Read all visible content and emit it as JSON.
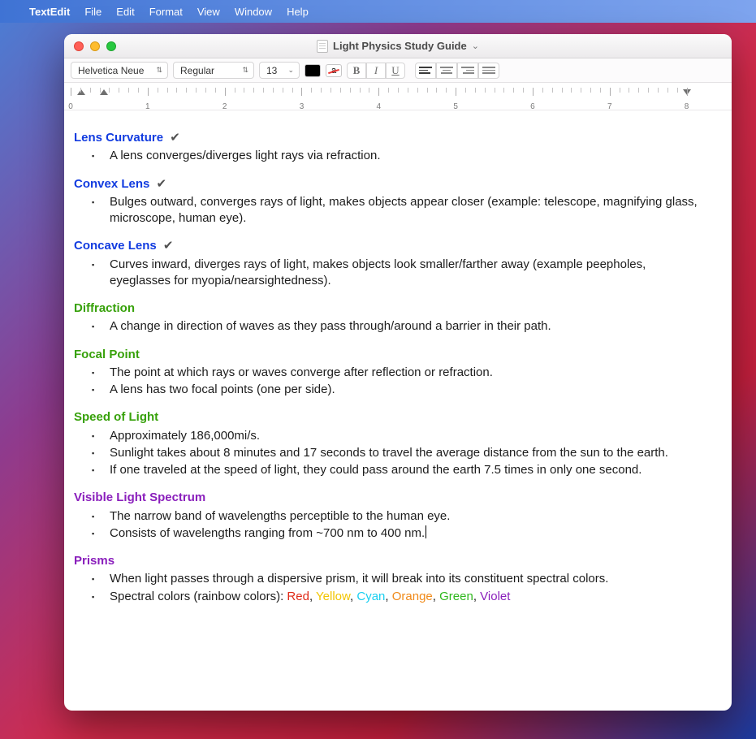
{
  "menubar": {
    "app": "TextEdit",
    "items": [
      "File",
      "Edit",
      "Format",
      "View",
      "Window",
      "Help"
    ]
  },
  "window": {
    "title": "Light Physics Study Guide"
  },
  "toolbar": {
    "font": "Helvetica Neue",
    "style": "Regular",
    "size": "13"
  },
  "ruler": {
    "numbers": [
      "0",
      "1",
      "2",
      "3",
      "4",
      "5",
      "6",
      "7",
      "8"
    ]
  },
  "sections": [
    {
      "title": "Lens Curvature",
      "color": "blue",
      "checked": true,
      "items": [
        "A lens converges/diverges light rays via refraction."
      ]
    },
    {
      "title": "Convex Lens",
      "color": "blue",
      "checked": true,
      "items": [
        "Bulges outward, converges rays of light, makes objects appear closer (example: telescope, magnifying glass, microscope, human eye)."
      ]
    },
    {
      "title": "Concave Lens",
      "color": "blue",
      "checked": true,
      "items": [
        "Curves inward, diverges rays of light, makes objects look smaller/farther away (example peepholes, eyeglasses for myopia/nearsightedness)."
      ]
    },
    {
      "title": "Diffraction",
      "color": "green",
      "checked": false,
      "items": [
        "A change in direction of waves as they pass through/around a barrier in their path."
      ]
    },
    {
      "title": "Focal Point",
      "color": "green",
      "checked": false,
      "items": [
        "The point at which rays or waves converge after reflection or refraction.",
        "A lens has two focal points (one per side)."
      ]
    },
    {
      "title": "Speed of Light",
      "color": "green",
      "checked": false,
      "items": [
        "Approximately 186,000mi/s.",
        "Sunlight takes about 8 minutes and 17 seconds to travel the average distance from the sun to the earth.",
        "If one traveled at the speed of light, they could pass around the earth 7.5 times in only one second."
      ]
    },
    {
      "title": "Visible Light Spectrum",
      "color": "purple",
      "checked": false,
      "items": [
        "The narrow band of wavelengths perceptible to the human eye.",
        "Consists of wavelengths ranging from ~700 nm to 400 nm."
      ],
      "cursor_after_item": 1
    },
    {
      "title": "Prisms",
      "color": "purple",
      "checked": false,
      "items": [
        "When light passes through a dispersive prism, it will break into its constituent spectral colors."
      ],
      "spectral": {
        "prefix": "Spectral colors (rainbow colors): ",
        "colors": [
          {
            "name": "Red",
            "class": "sc-red"
          },
          {
            "name": "Yellow",
            "class": "sc-yellow"
          },
          {
            "name": "Cyan",
            "class": "sc-cyan"
          },
          {
            "name": "Orange",
            "class": "sc-orange"
          },
          {
            "name": "Green",
            "class": "sc-green"
          },
          {
            "name": "Violet",
            "class": "sc-violet"
          }
        ]
      }
    }
  ]
}
